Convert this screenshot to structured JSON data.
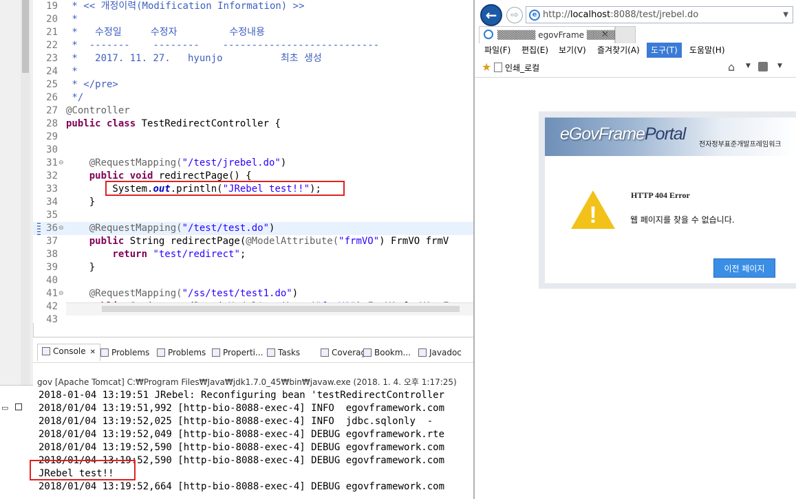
{
  "editor": {
    "lines": [
      {
        "n": "19",
        "parts": [
          {
            "t": " * << 개정이력(Modification Information) >>",
            "c": "cm"
          }
        ]
      },
      {
        "n": "20",
        "parts": [
          {
            "t": " *",
            "c": "cm"
          }
        ]
      },
      {
        "n": "21",
        "parts": [
          {
            "t": " *   수정일     수정자         수정내용",
            "c": "cm"
          }
        ]
      },
      {
        "n": "22",
        "parts": [
          {
            "t": " *  -------    --------    ---------------------------",
            "c": "cm"
          }
        ]
      },
      {
        "n": "23",
        "parts": [
          {
            "t": " *   2017. 11. 27.   hyunjo          최초 생성",
            "c": "cm"
          }
        ]
      },
      {
        "n": "24",
        "parts": [
          {
            "t": " *",
            "c": "cm"
          }
        ]
      },
      {
        "n": "25",
        "parts": [
          {
            "t": " * </pre>",
            "c": "cm"
          }
        ]
      },
      {
        "n": "26",
        "parts": [
          {
            "t": " */",
            "c": "cm"
          }
        ]
      },
      {
        "n": "27",
        "parts": [
          {
            "t": "@Controller",
            "c": "ann"
          }
        ]
      },
      {
        "n": "28",
        "parts": [
          {
            "t": "public class ",
            "c": "kw"
          },
          {
            "t": "TestRedirectController {",
            "c": ""
          }
        ]
      },
      {
        "n": "29",
        "parts": []
      },
      {
        "n": "30",
        "parts": []
      },
      {
        "n": "31",
        "fold": true,
        "parts": [
          {
            "t": "    @RequestMapping(",
            "c": "ann"
          },
          {
            "t": "\"/test/jrebel.do\"",
            "c": "str"
          },
          {
            "t": ")",
            "c": ""
          }
        ]
      },
      {
        "n": "32",
        "parts": [
          {
            "t": "    public void ",
            "c": "kw"
          },
          {
            "t": "redirectPage() {",
            "c": ""
          }
        ]
      },
      {
        "n": "33",
        "parts": [
          {
            "t": "        System.",
            "c": ""
          },
          {
            "t": "out",
            "c": "fld"
          },
          {
            "t": ".println(",
            "c": ""
          },
          {
            "t": "\"JRebel test!!\"",
            "c": "str"
          },
          {
            "t": ");",
            "c": ""
          }
        ]
      },
      {
        "n": "34",
        "parts": [
          {
            "t": "    }",
            "c": ""
          }
        ]
      },
      {
        "n": "35",
        "parts": []
      },
      {
        "n": "36",
        "fold": true,
        "hl": true,
        "parts": [
          {
            "t": "    @RequestMapping(",
            "c": "ann"
          },
          {
            "t": "\"/test/test.do\"",
            "c": "str"
          },
          {
            "t": ")",
            "c": ""
          }
        ]
      },
      {
        "n": "37",
        "parts": [
          {
            "t": "    public ",
            "c": "kw"
          },
          {
            "t": "String redirectPage(",
            "c": ""
          },
          {
            "t": "@ModelAttribute(",
            "c": "ann"
          },
          {
            "t": "\"frmVO\"",
            "c": "str"
          },
          {
            "t": ") FrmVO frmV",
            "c": ""
          }
        ]
      },
      {
        "n": "38",
        "parts": [
          {
            "t": "        return ",
            "c": "kw"
          },
          {
            "t": "\"test/redirect\"",
            "c": "str"
          },
          {
            "t": ";",
            "c": ""
          }
        ]
      },
      {
        "n": "39",
        "parts": [
          {
            "t": "    }",
            "c": ""
          }
        ]
      },
      {
        "n": "40",
        "parts": []
      },
      {
        "n": "41",
        "fold": true,
        "parts": [
          {
            "t": "    @RequestMapping(",
            "c": "ann"
          },
          {
            "t": "\"/ss/test/test1.do\"",
            "c": "str"
          },
          {
            "t": ")",
            "c": ""
          }
        ]
      },
      {
        "n": "42",
        "parts": [
          {
            "t": "    public ",
            "c": "kw"
          },
          {
            "t": "String sendPage(",
            "c": ""
          },
          {
            "t": "@ModelAttribute(",
            "c": "ann"
          },
          {
            "t": "\"frmVO\"",
            "c": "str"
          },
          {
            "t": ") FrmVO frmVO, F",
            "c": ""
          }
        ]
      },
      {
        "n": "43",
        "parts": []
      }
    ]
  },
  "console": {
    "tabs": [
      {
        "label": "Console",
        "active": true,
        "close": "✕"
      },
      {
        "label": "Problems"
      },
      {
        "label": "Problems"
      },
      {
        "label": "Properti..."
      },
      {
        "label": "Tasks"
      },
      {
        "label": "Coverage"
      },
      {
        "label": "Bookm..."
      },
      {
        "label": "Javadoc"
      }
    ],
    "description": "gov [Apache Tomcat] C:₩Program Files₩Java₩jdk1.7.0_45₩bin₩javaw.exe (2018. 1. 4. 오후 1:17:25)",
    "lines": [
      "2018-01-04 13:19:51 JRebel: Reconfiguring bean 'testRedirectController",
      "2018/01/04 13:19:51,992 [http-bio-8088-exec-4] INFO  egovframework.com",
      "2018/01/04 13:19:52,025 [http-bio-8088-exec-4] INFO  jdbc.sqlonly  -",
      "2018/01/04 13:19:52,049 [http-bio-8088-exec-4] DEBUG egovframework.rte",
      "2018/01/04 13:19:52,590 [http-bio-8088-exec-4] DEBUG egovframework.com",
      "2018/01/04 13:19:52,590 [http-bio-8088-exec-4] DEBUG egovframework.com",
      "JRebel test!!",
      "2018/01/04 13:19:52,664 [http-bio-8088-exec-4] DEBUG egovframework.com"
    ]
  },
  "browser": {
    "url_prefix": "http://",
    "url_host": "localhost",
    "url_rest": ":8088/test/jrebel.do",
    "tab_title": "▒▒▒▒▒▒ egovFrame ▒▒▒▒▒▒",
    "tab_close": "✕",
    "menus": [
      "파일(F)",
      "편집(E)",
      "보기(V)",
      "즐겨찾기(A)",
      "도구(T)",
      "도움말(H)"
    ],
    "active_menu_index": 4,
    "favorite": "인쇄_로컬",
    "page": {
      "logo_main": "eGovFrame",
      "logo_portal": "Portal",
      "logo_sub": "전자정부표준개발프레임워크",
      "error_title": "HTTP 404 Error",
      "error_message": "웹 페이지를 찾을 수 없습니다.",
      "prev_button": "이전 페이지"
    }
  }
}
